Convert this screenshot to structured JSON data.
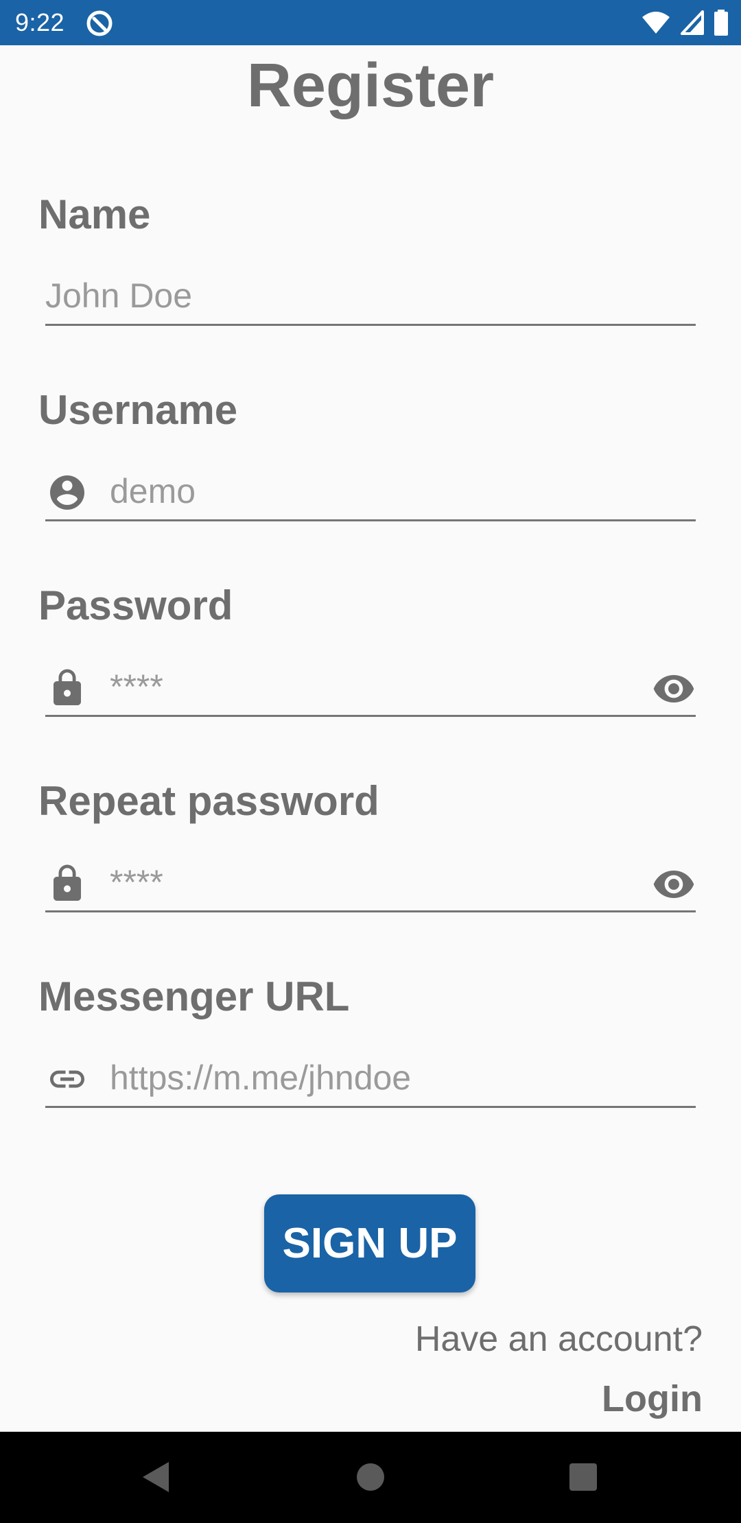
{
  "status_bar": {
    "time": "9:22",
    "color": "#1a63a6"
  },
  "page": {
    "title": "Register"
  },
  "fields": {
    "name": {
      "label": "Name",
      "placeholder": "John Doe"
    },
    "username": {
      "label": "Username",
      "placeholder": "demo",
      "icon": "account-circle-icon"
    },
    "password": {
      "label": "Password",
      "placeholder": "****",
      "icon": "lock-icon",
      "toggle_icon": "eye-icon"
    },
    "repeat_password": {
      "label": "Repeat password",
      "placeholder": "****",
      "icon": "lock-icon",
      "toggle_icon": "eye-icon"
    },
    "messenger_url": {
      "label": "Messenger URL",
      "placeholder": "https://m.me/jhndoe",
      "icon": "link-icon"
    }
  },
  "actions": {
    "signup_label": "SIGN UP",
    "have_account_text": "Have an account?",
    "login_label": "Login"
  },
  "colors": {
    "primary": "#1a63a6",
    "text": "#6e6e6e",
    "background": "#fafafa"
  }
}
